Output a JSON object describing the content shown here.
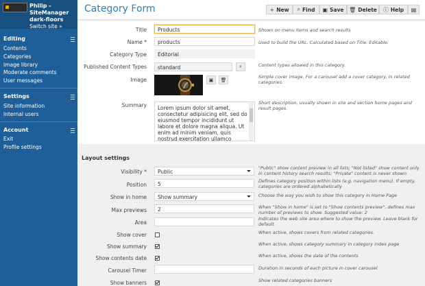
{
  "sidebar": {
    "user_line1": "Philip -",
    "user_line2": "SiteManager",
    "user_line3": "dark-floors",
    "switch_site": "Switch site »",
    "sections": [
      {
        "title": "Editing",
        "items": [
          "Contents",
          "Categories",
          "Image library",
          "Moderate comments",
          "User messages"
        ]
      },
      {
        "title": "Settings",
        "items": [
          "Site information",
          "Internal users"
        ]
      },
      {
        "title": "Account",
        "items": [
          "Exit",
          "Profile settings"
        ]
      }
    ]
  },
  "header": {
    "title": "Category Form",
    "buttons": {
      "new": "New",
      "find": "Find",
      "save": "Save",
      "delete": "Delete",
      "help": "Help"
    }
  },
  "form": {
    "title": {
      "label": "Title",
      "value": "Products",
      "help": "Shown on menu items and search results"
    },
    "name": {
      "label": "Name *",
      "value": "products",
      "help": "Used to build the URL. Calculated based on Title. Editable."
    },
    "category_type": {
      "label": "Category Type",
      "value": "Editorial"
    },
    "published_types": {
      "label": "Published Content Types",
      "value": "standard",
      "help": "Content types allowed in this category."
    },
    "image": {
      "label": "Image",
      "help": "Simple cover image. For a carousel add a cover category, in related categories."
    },
    "summary": {
      "label": "Summary",
      "value": "Lorem ipsum dolor sit amet, consectetur adipisicing elit, sed do eiusmod tempor incididunt ut labore et dolore magna aliqua. Ut enim ad minim veniam, quis nostrud exercitation ullamco laboris nisi ut",
      "help": "Short description, usually shown in site and section home pages and result pages."
    }
  },
  "layout": {
    "section_title": "Layout settings",
    "visibility": {
      "label": "Visibility *",
      "value": "Public",
      "help": "\"Public\" show content preview in all lists; \"Not listed\" show content only in content history search results; \"Private\" content is never shown"
    },
    "position": {
      "label": "Position",
      "value": "5",
      "help": "Defines category position within lists (e.g. navigation menu). If empty, categories are ordered alphabetically"
    },
    "show_in_home": {
      "label": "Show in home",
      "value": "Show summary",
      "help": "Choose the way you wish to show this category in Home Page"
    },
    "max_previews": {
      "label": "Max previews",
      "value": "2",
      "help": "When \"Show in home\" is set to \"Show contents preview\", defines max number of previews to show. Suggested value: 2"
    },
    "area": {
      "label": "Area",
      "value": "",
      "help": "Indicates the web site area where to show the preview. Leave blank for default"
    },
    "show_cover": {
      "label": "Show cover",
      "checked": false,
      "help": "When active, shows covers from related categories."
    },
    "show_summary": {
      "label": "Show summary",
      "checked": true,
      "help": "When active, shows category summary in category index page"
    },
    "show_contents_date": {
      "label": "Show contents date",
      "checked": true,
      "help": "When active, shows the date of the contents"
    },
    "carousel_timer": {
      "label": "Carousel Timer",
      "value": "",
      "help": "Duration in seconds of each picture in cover carousel"
    },
    "show_banners": {
      "label": "Show banners",
      "checked": true,
      "help": "Show related categories banners"
    }
  },
  "colors": {
    "sidebar": "#1e5f99",
    "title": "#2f7cc0",
    "focus": "#e8b84a"
  }
}
